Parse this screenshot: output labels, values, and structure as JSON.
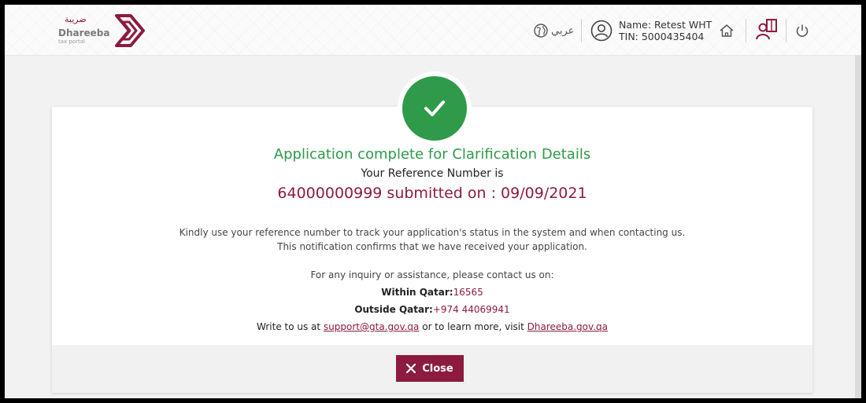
{
  "header": {
    "logo_arabic": "ضريبة",
    "logo_name": "Dhareeba",
    "logo_sub": "tax portal",
    "language_label": "عربي",
    "user_name": "Name: Retest WHT",
    "user_tin": "TIN: 5000435404"
  },
  "confirmation": {
    "title": "Application complete for Clarification Details",
    "reference_label": "Your Reference Number is",
    "reference_text": "64000000999 submitted on : 09/09/2021",
    "para_line1": "Kindly use your reference number to track your application's status in the system and when contacting us.",
    "para_line2": "This notification confirms that we have received your application.",
    "inquiry": "For any inquiry or assistance, please contact us on:",
    "within_label": "Within Qatar:",
    "within_value": "16565",
    "outside_label": "Outside Qatar:",
    "outside_value": "+974 44069941",
    "write_prefix": "Write to us at ",
    "email": "support@gta.gov.qa",
    "write_mid": " or to learn more, visit ",
    "website": "Dhareeba.gov.qa"
  },
  "actions": {
    "close_label": "Close"
  },
  "colors": {
    "brand": "#8c1b3f",
    "success": "#2e9a4a"
  }
}
